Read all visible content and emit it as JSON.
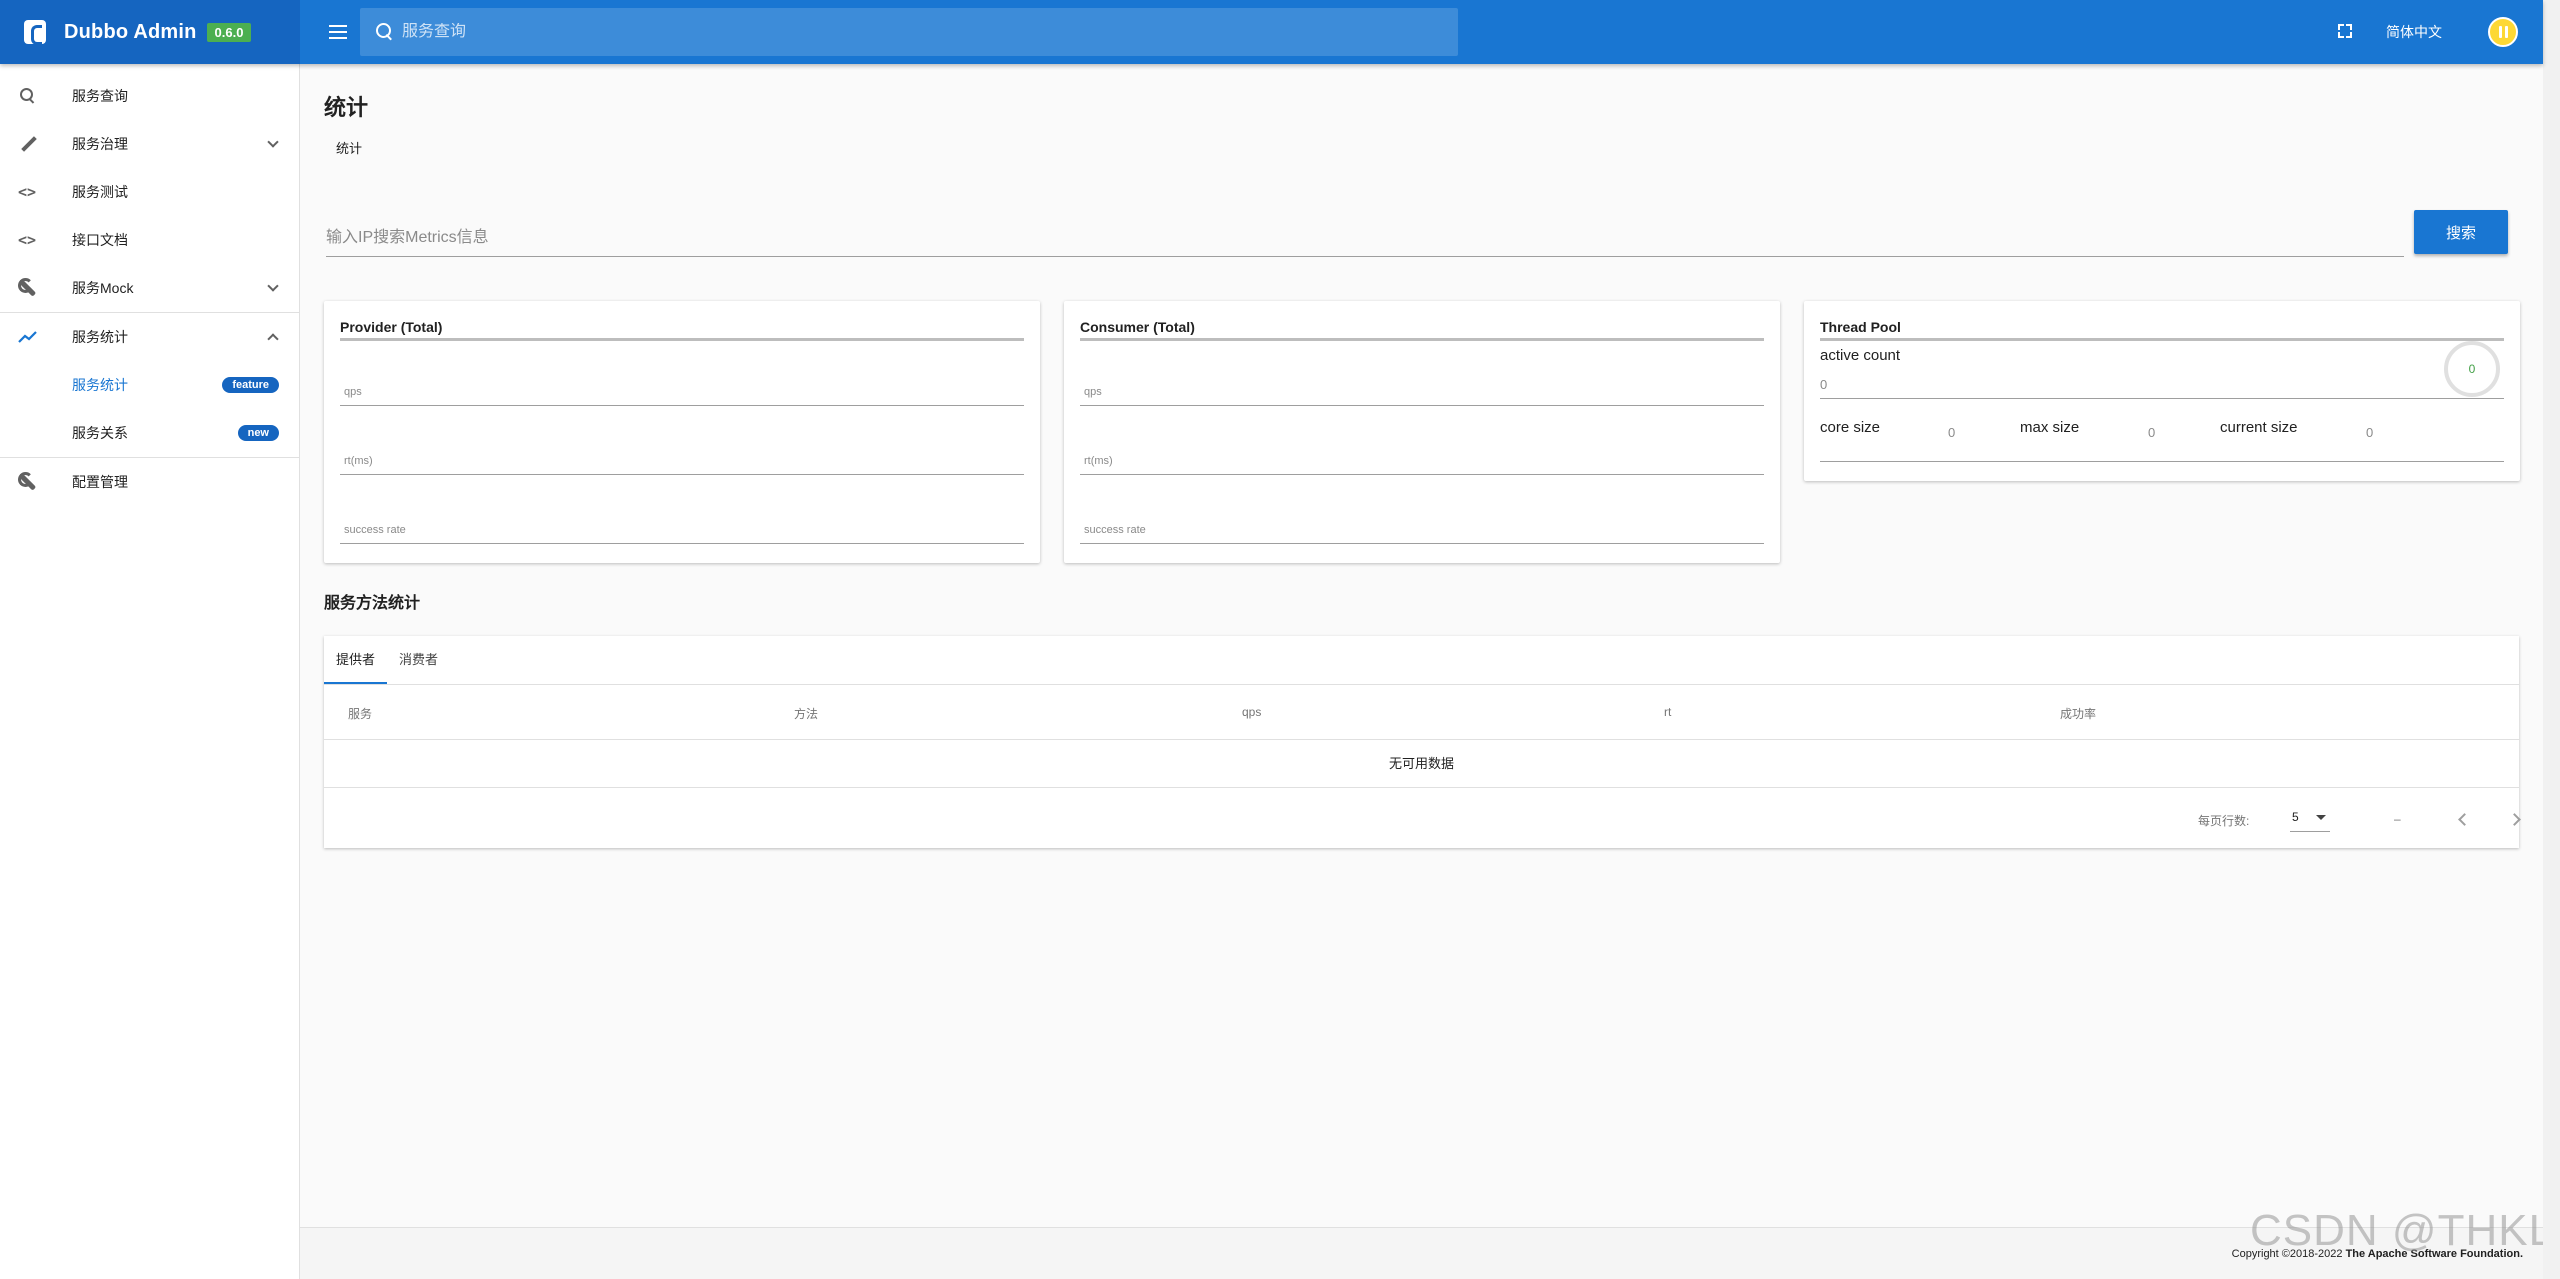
{
  "header": {
    "brand": "Dubbo Admin",
    "version": "0.6.0",
    "search_placeholder": "服务查询",
    "language": "简体中文"
  },
  "sidebar": {
    "items": [
      {
        "label": "服务查询",
        "icon": "search-icon"
      },
      {
        "label": "服务治理",
        "icon": "pencil-icon"
      },
      {
        "label": "服务测试",
        "icon": "code-icon"
      },
      {
        "label": "接口文档",
        "icon": "code-icon"
      },
      {
        "label": "服务Mock",
        "icon": "wrench-icon"
      },
      {
        "label": "服务统计",
        "icon": "trending-up-icon"
      },
      {
        "label": "配置管理",
        "icon": "wrench-icon"
      }
    ],
    "sub_items": [
      {
        "label": "服务统计",
        "badge": "feature"
      },
      {
        "label": "服务关系",
        "badge": "new"
      }
    ]
  },
  "main": {
    "title": "统计",
    "breadcrumb": "统计",
    "ip_placeholder": "输入IP搜索Metrics信息",
    "search_button": "搜索",
    "provider": {
      "title": "Provider (Total)",
      "fields": [
        "qps",
        "rt(ms)",
        "success rate"
      ]
    },
    "consumer": {
      "title": "Consumer (Total)",
      "fields": [
        "qps",
        "rt(ms)",
        "success rate"
      ]
    },
    "thread_pool": {
      "title": "Thread Pool",
      "active_count_label": "active count",
      "active_count_value": "0",
      "ring_value": "0",
      "core_size_label": "core size",
      "core_size_value": "0",
      "max_size_label": "max size",
      "max_size_value": "0",
      "current_size_label": "current size",
      "current_size_value": "0"
    },
    "method_section_title": "服务方法统计",
    "tabs": [
      "提供者",
      "消费者"
    ],
    "columns": [
      "服务",
      "方法",
      "qps",
      "rt",
      "成功率"
    ],
    "empty_text": "无可用数据",
    "rows_per_page_label": "每页行数:",
    "rows_per_page_value": "5",
    "page_range": "–"
  },
  "footer": {
    "copyright": "Copyright ©2018-2022",
    "foundation": "The Apache Software Foundation."
  },
  "watermark": "CSDN @THKL",
  "colors": {
    "primary": "#1976d2",
    "brand_bg": "#1565c0",
    "version_badge": "#4caf50",
    "badge": "#1565c0"
  }
}
